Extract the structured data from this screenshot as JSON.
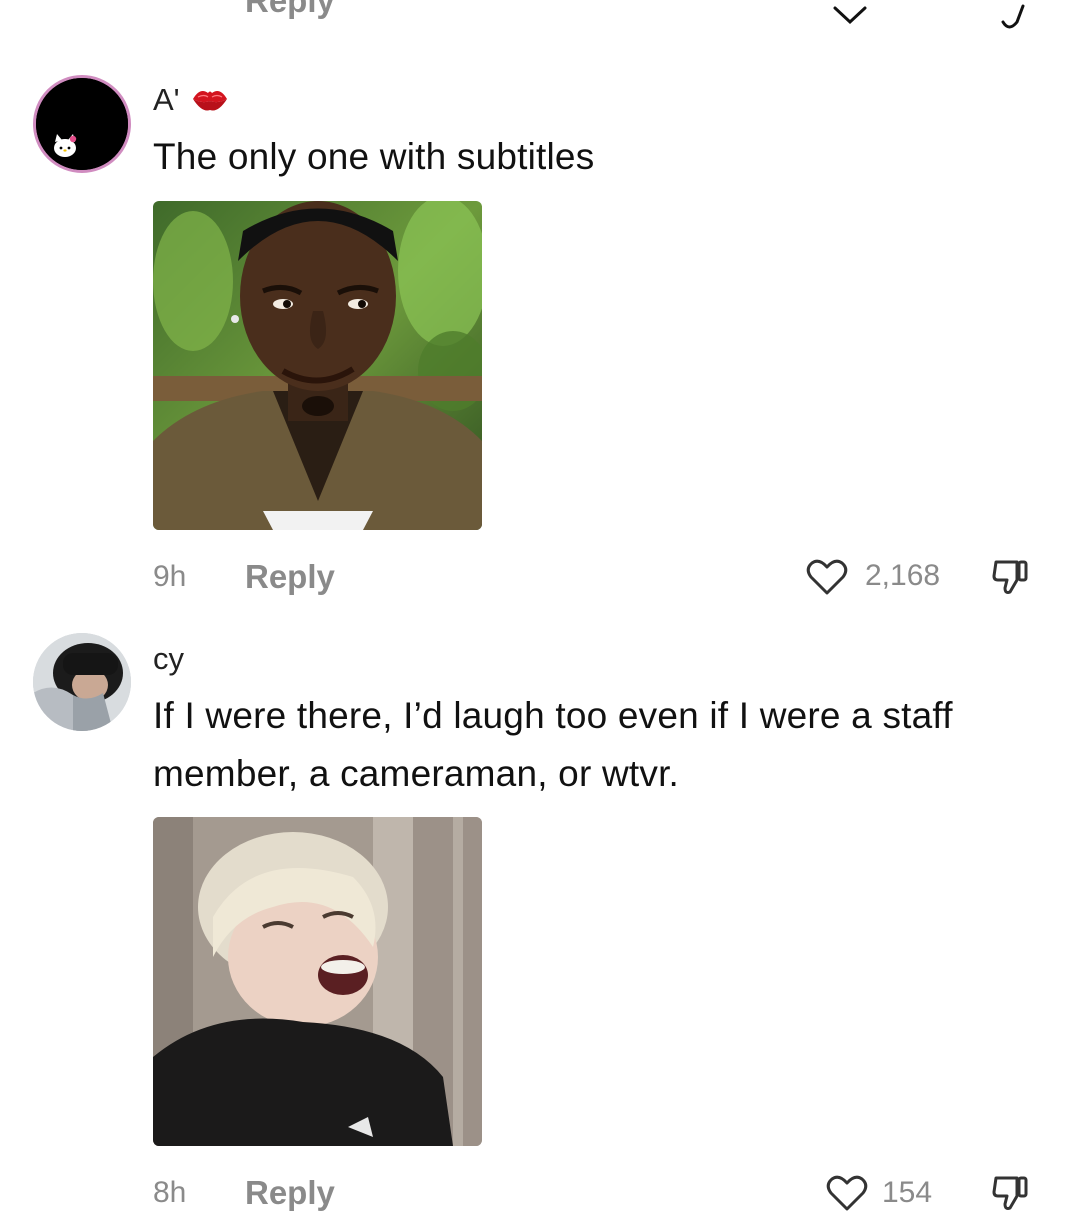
{
  "colors": {
    "background": "#ffffff",
    "meta_gray": "#8a8a8a",
    "avatar_ring": "#d08cc0"
  },
  "comments": [
    {
      "username": "A'",
      "username_emoji": "kiss-lips-icon",
      "text": "The only one with subtitles",
      "time": "9h",
      "reply_label": "Reply",
      "likes": "2,168"
    },
    {
      "username": "cy",
      "text": "If I were there, I’d laugh too even if I were a staff member, a cameraman, or wtvr.",
      "time": "8h",
      "reply_label": "Reply",
      "likes": "154"
    }
  ],
  "top_clipped": {
    "reply_label": "Reply"
  }
}
